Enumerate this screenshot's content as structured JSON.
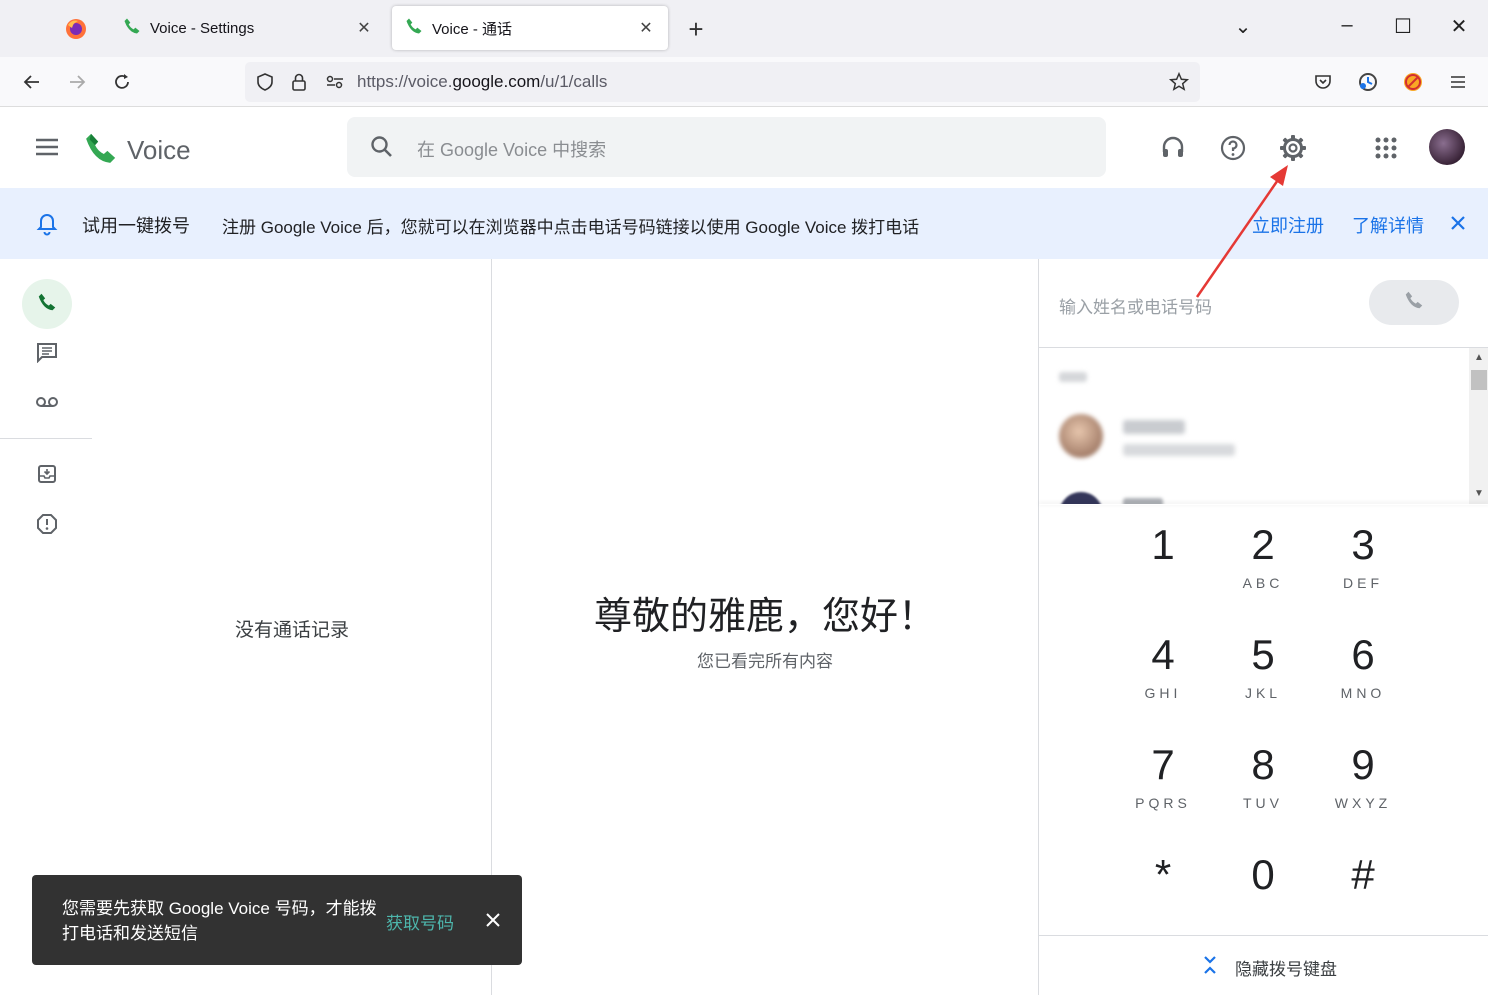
{
  "browser": {
    "tabs": [
      {
        "label": "Voice - Settings",
        "active": false
      },
      {
        "label": "Voice - 通话",
        "active": true
      }
    ],
    "new_tab": "+",
    "url_prefix": "https://voice.",
    "url_domain": "google.com",
    "url_path": "/u/1/calls"
  },
  "app": {
    "name": "Voice",
    "search_placeholder": "在 Google Voice 中搜索"
  },
  "banner": {
    "title": "试用一键拨号",
    "text": "注册 Google Voice 后，您就可以在浏览器中点击电话号码链接以使用 Google Voice 拨打电话",
    "signup": "立即注册",
    "learn_more": "了解详情"
  },
  "calls": {
    "empty": "没有通话记录"
  },
  "main": {
    "greeting": "尊敬的雅鹿，您好！",
    "subtitle": "您已看完所有内容"
  },
  "dialer": {
    "input_placeholder": "输入姓名或电话号码",
    "keys": [
      {
        "num": "1",
        "letters": ""
      },
      {
        "num": "2",
        "letters": "ABC"
      },
      {
        "num": "3",
        "letters": "DEF"
      },
      {
        "num": "4",
        "letters": "GHI"
      },
      {
        "num": "5",
        "letters": "JKL"
      },
      {
        "num": "6",
        "letters": "MNO"
      },
      {
        "num": "7",
        "letters": "PQRS"
      },
      {
        "num": "8",
        "letters": "TUV"
      },
      {
        "num": "9",
        "letters": "WXYZ"
      },
      {
        "num": "*",
        "letters": ""
      },
      {
        "num": "0",
        "letters": ""
      },
      {
        "num": "#",
        "letters": ""
      }
    ],
    "hide_keypad": "隐藏拨号键盘"
  },
  "toast": {
    "message": "您需要先获取 Google Voice 号码，才能拨打电话和发送短信",
    "action": "获取号码"
  },
  "colors": {
    "voice_green": "#34a853",
    "link_blue": "#1a73e8",
    "banner_bg": "#e8f0fe",
    "annotation_red": "#e53935",
    "toast_action": "#4db6ac"
  }
}
